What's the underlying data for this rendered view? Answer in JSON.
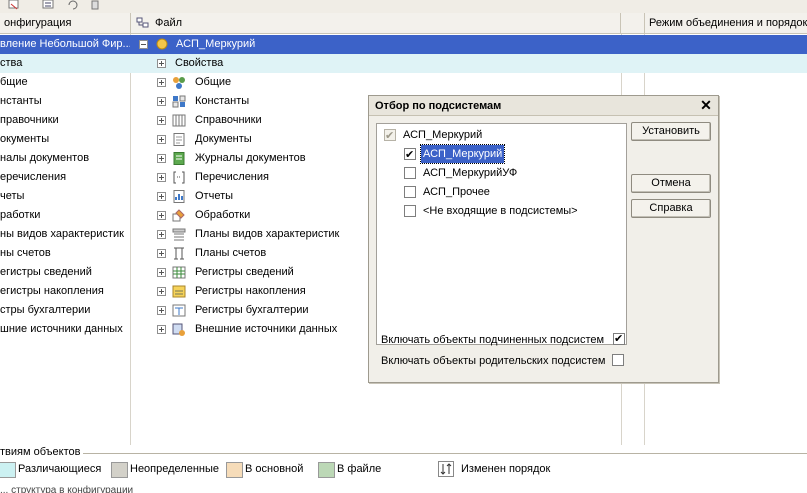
{
  "header": {
    "col_config": "онфигурация",
    "col_file": "Файл",
    "col_mode": "Режим объединения и порядок"
  },
  "tree": {
    "selected_left": "вление Небольшой Фир...",
    "selected_right": "АСП_Меркурий",
    "highlighted_right": "Свойства",
    "left_items": [
      "ства",
      "бщие",
      "нстанты",
      "правочники",
      "окументы",
      "налы документов",
      "еречисления",
      "четы",
      "работки",
      "ны видов характеристик",
      "ны счетов",
      "егистры сведений",
      "егистры накопления",
      "стры бухгалтерии",
      "шние источники данных"
    ],
    "right_items": [
      {
        "label": "Общие",
        "icon": "common-icon"
      },
      {
        "label": "Константы",
        "icon": "constants-icon"
      },
      {
        "label": "Справочники",
        "icon": "catalogs-icon"
      },
      {
        "label": "Документы",
        "icon": "documents-icon"
      },
      {
        "label": "Журналы документов",
        "icon": "journals-icon"
      },
      {
        "label": "Перечисления",
        "icon": "enums-icon"
      },
      {
        "label": "Отчеты",
        "icon": "reports-icon"
      },
      {
        "label": "Обработки",
        "icon": "processing-icon"
      },
      {
        "label": "Планы видов характеристик",
        "icon": "char-plans-icon"
      },
      {
        "label": "Планы счетов",
        "icon": "accounts-icon"
      },
      {
        "label": "Регистры сведений",
        "icon": "info-registers-icon"
      },
      {
        "label": "Регистры накопления",
        "icon": "accum-registers-icon"
      },
      {
        "label": "Регистры бухгалтерии",
        "icon": "acc-registers-icon"
      },
      {
        "label": "Внешние источники данных",
        "icon": "external-sources-icon"
      }
    ]
  },
  "legend": {
    "title": "твиям объектов",
    "items": [
      {
        "label": "Различающиеся",
        "color": "#ccf1f2"
      },
      {
        "label": "Неопределенные",
        "color": "#d3d1c9"
      },
      {
        "label": "В основной",
        "color": "#f6dcb9"
      },
      {
        "label": "В файле",
        "color": "#bcd8b6"
      },
      {
        "label": "Изменен порядок",
        "color": ""
      }
    ],
    "bottom_text": "... структура в конфигурации"
  },
  "dialog": {
    "title": "Отбор по подсистемам",
    "root": "АСП_Меркурий",
    "items": [
      {
        "label": "АСП_Меркурий",
        "checked": true
      },
      {
        "label": "АСП_МеркурийУФ",
        "checked": false
      },
      {
        "label": "АСП_Прочее",
        "checked": false
      },
      {
        "label": "<Не входящие в подсистемы>",
        "checked": false
      }
    ],
    "buttons": {
      "set": "Установить",
      "cancel": "Отмена",
      "help": "Справка"
    },
    "include_sub": "Включать объекты подчиненных подсистем",
    "include_parent": "Включать объекты родительских подсистем"
  }
}
